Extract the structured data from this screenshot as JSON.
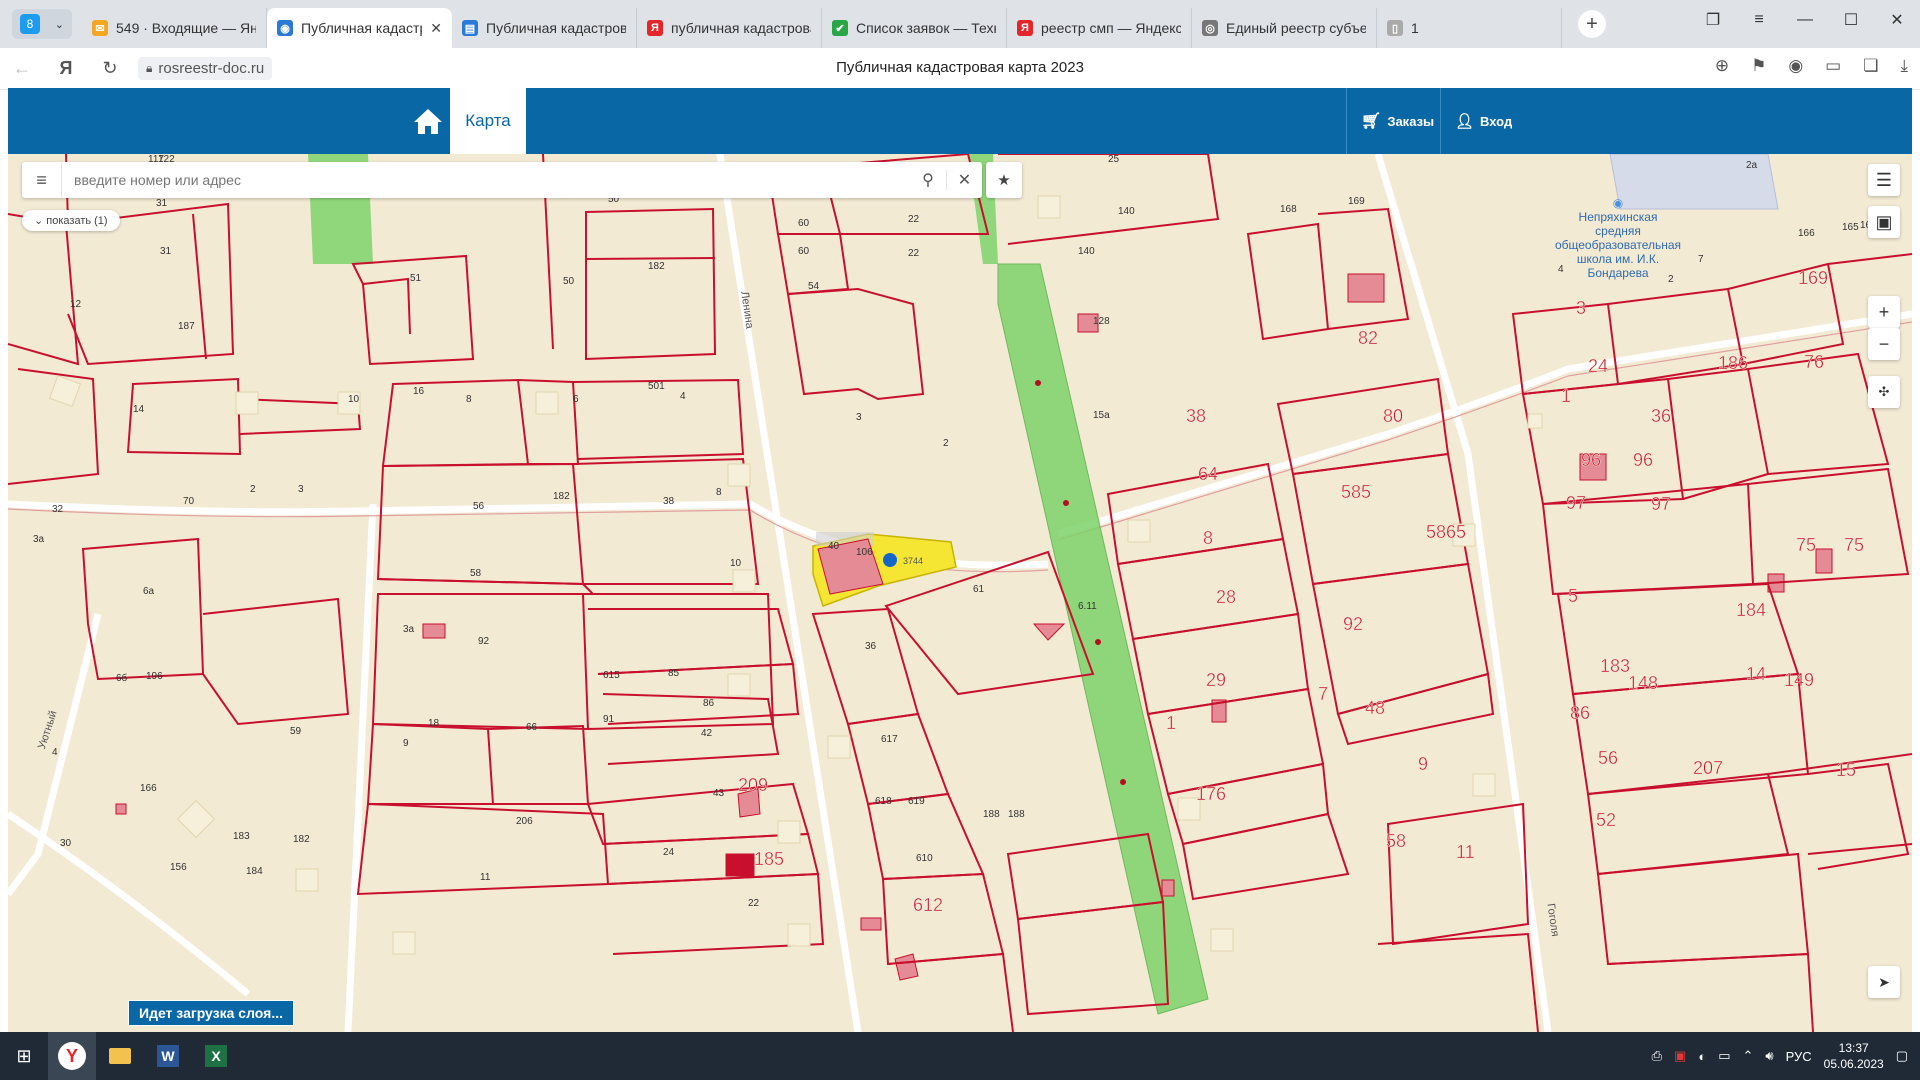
{
  "browser": {
    "tab_count": "8",
    "tabs": [
      {
        "title": "549 · Входящие — Яндекс",
        "icon": "mail-icon",
        "active": false
      },
      {
        "title": "Публичная кадастровая",
        "icon": "map-icon",
        "active": true
      },
      {
        "title": "Публичная кадастровая",
        "icon": "doc-icon",
        "active": false
      },
      {
        "title": "публичная кадастровая",
        "icon": "yandex-icon",
        "active": false
      },
      {
        "title": "Список заявок — Техно",
        "icon": "check-icon",
        "active": false
      },
      {
        "title": "реестр смп — Яндекс: н",
        "icon": "yandex-icon",
        "active": false
      },
      {
        "title": "Единый реестр субъект",
        "icon": "globe-icon",
        "active": false
      },
      {
        "title": "1",
        "icon": "file-icon",
        "active": false
      }
    ],
    "url": "rosreestr-doc.ru",
    "page_title": "Публичная кадастровая карта 2023"
  },
  "header": {
    "map_tab": "Карта",
    "orders": "Заказы",
    "login": "Вход"
  },
  "search": {
    "placeholder": "введите номер или адрес",
    "show_button": "показать (1)"
  },
  "map": {
    "selected_parcel": "3744",
    "school_label": [
      "Непряхинская",
      "средняя",
      "общеобразовательная",
      "школа им. И.К.",
      "Бондарева"
    ],
    "streets": [
      "Ленина",
      "Уютный",
      "Гоголя"
    ],
    "parcel_labels": [
      {
        "t": "122"
      },
      {
        "t": "117"
      },
      {
        "t": "25"
      },
      {
        "t": "2а"
      },
      {
        "t": "31"
      },
      {
        "t": "31"
      },
      {
        "t": "50"
      },
      {
        "t": "60"
      },
      {
        "t": "60"
      },
      {
        "t": "22"
      },
      {
        "t": "22"
      },
      {
        "t": "140"
      },
      {
        "t": "140"
      },
      {
        "t": "12"
      },
      {
        "t": "187"
      },
      {
        "t": "51"
      },
      {
        "t": "182"
      },
      {
        "t": "50"
      },
      {
        "t": "54"
      },
      {
        "t": "128"
      },
      {
        "t": "16"
      },
      {
        "t": "10"
      },
      {
        "t": "8"
      },
      {
        "t": "6"
      },
      {
        "t": "501"
      },
      {
        "t": "4"
      },
      {
        "t": "3"
      },
      {
        "t": "14"
      },
      {
        "t": "2"
      },
      {
        "t": "15а"
      },
      {
        "t": "70"
      },
      {
        "t": "2"
      },
      {
        "t": "3"
      },
      {
        "t": "56"
      },
      {
        "t": "182"
      },
      {
        "t": "38"
      },
      {
        "t": "8"
      },
      {
        "t": "32"
      },
      {
        "t": "3а"
      },
      {
        "t": "58"
      },
      {
        "t": "10"
      },
      {
        "t": "40"
      },
      {
        "t": "106"
      },
      {
        "t": "61"
      },
      {
        "t": "6.11"
      },
      {
        "t": "6а"
      },
      {
        "t": "3а"
      },
      {
        "t": "92"
      },
      {
        "t": "36"
      },
      {
        "t": "6б"
      },
      {
        "t": "196"
      },
      {
        "t": "615"
      },
      {
        "t": "85"
      },
      {
        "t": "86"
      },
      {
        "t": "59"
      },
      {
        "t": "18"
      },
      {
        "t": "66"
      },
      {
        "t": "91"
      },
      {
        "t": "42"
      },
      {
        "t": "617"
      },
      {
        "t": "9"
      },
      {
        "t": "4"
      },
      {
        "t": "166"
      },
      {
        "t": "43"
      },
      {
        "t": "618"
      },
      {
        "t": "619"
      },
      {
        "t": "188"
      },
      {
        "t": "188"
      },
      {
        "t": "30"
      },
      {
        "t": "183"
      },
      {
        "t": "182"
      },
      {
        "t": "206"
      },
      {
        "t": "24"
      },
      {
        "t": "610"
      },
      {
        "t": "156"
      },
      {
        "t": "184"
      },
      {
        "t": "11"
      },
      {
        "t": "22"
      },
      {
        "t": "168"
      },
      {
        "t": "169"
      },
      {
        "t": "4"
      },
      {
        "t": "2"
      },
      {
        "t": "7"
      },
      {
        "t": "166"
      },
      {
        "t": "169"
      },
      {
        "t": "165"
      },
      {
        "t": "165"
      },
      {
        "t": "3"
      },
      {
        "t": "82"
      },
      {
        "t": "24"
      },
      {
        "t": "186"
      },
      {
        "t": "76"
      },
      {
        "t": "38"
      },
      {
        "t": "80"
      },
      {
        "t": "36"
      },
      {
        "t": "1"
      },
      {
        "t": "64"
      },
      {
        "t": "96"
      },
      {
        "t": "96"
      },
      {
        "t": "97"
      },
      {
        "t": "97"
      },
      {
        "t": "585"
      },
      {
        "t": "8"
      },
      {
        "t": "5865"
      },
      {
        "t": "75"
      },
      {
        "t": "75"
      },
      {
        "t": "28"
      },
      {
        "t": "92"
      },
      {
        "t": "5"
      },
      {
        "t": "184"
      },
      {
        "t": "29"
      },
      {
        "t": "1"
      },
      {
        "t": "183"
      },
      {
        "t": "148"
      },
      {
        "t": "14"
      },
      {
        "t": "149"
      },
      {
        "t": "7"
      },
      {
        "t": "48"
      },
      {
        "t": "86"
      },
      {
        "t": "9"
      },
      {
        "t": "56"
      },
      {
        "t": "15"
      },
      {
        "t": "207"
      },
      {
        "t": "52"
      },
      {
        "t": "11"
      },
      {
        "t": "58"
      },
      {
        "t": "176"
      },
      {
        "t": "612"
      },
      {
        "t": "185"
      },
      {
        "t": "209"
      }
    ]
  },
  "status": {
    "loading": "Идет загрузка слоя..."
  },
  "taskbar": {
    "lang": "РУС",
    "time": "13:37",
    "date": "05.06.2023"
  },
  "colors": {
    "header": "#0967a6",
    "map_bg": "#f3ead4",
    "parcel_line": "#c8102e",
    "green_strip": "#7ed36b",
    "selected": "#f5e633"
  }
}
